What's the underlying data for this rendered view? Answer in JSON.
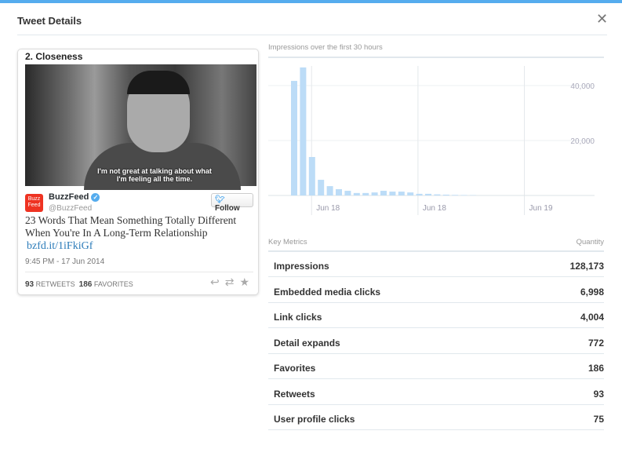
{
  "modal": {
    "title": "Tweet Details",
    "close_icon": "close-icon"
  },
  "tweet": {
    "heading": "2. Closeness",
    "image_caption": "I'm not great at talking about what I'm feeling all the time.",
    "logo_text": "Buzz Feed",
    "name": "BuzzFeed",
    "handle": "@BuzzFeed",
    "follow_label": "Follow",
    "text": "23 Words That Mean Something Totally Different When You're In A Long-Term Relationship",
    "link": "bzfd.it/1iFkiGf",
    "timestamp": "9:45 PM - 17 Jun 2014",
    "retweets": "93",
    "retweets_label": "RETWEETS",
    "favorites": "186",
    "favorites_label": "FAVORITES"
  },
  "chart_data": {
    "type": "bar",
    "title": "Impressions over the first 30 hours",
    "color": "#bcdcf7",
    "values": [
      41700,
      46600,
      14000,
      5700,
      3400,
      2300,
      1700,
      900,
      900,
      1100,
      1700,
      1400,
      1400,
      1100,
      600,
      600,
      400,
      300,
      200,
      150,
      100
    ],
    "ylim": [
      0,
      50000
    ],
    "yticks": [
      {
        "value": 20000,
        "label": "20,000"
      },
      {
        "value": 40000,
        "label": "40,000"
      }
    ],
    "xticks": [
      {
        "index": 2.3,
        "label": "Jun 18"
      },
      {
        "index": 14.2,
        "label": "Jun 18"
      },
      {
        "index": 26.1,
        "label": "Jun 19"
      }
    ],
    "grid": true
  },
  "metrics": {
    "header": "Key Metrics",
    "quantity_header": "Quantity",
    "rows": [
      {
        "label": "Impressions",
        "value": "128,173"
      },
      {
        "label": "Embedded media clicks",
        "value": "6,998"
      },
      {
        "label": "Link clicks",
        "value": "4,004"
      },
      {
        "label": "Detail expands",
        "value": "772"
      },
      {
        "label": "Favorites",
        "value": "186"
      },
      {
        "label": "Retweets",
        "value": "93"
      },
      {
        "label": "User profile clicks",
        "value": "75"
      }
    ]
  }
}
